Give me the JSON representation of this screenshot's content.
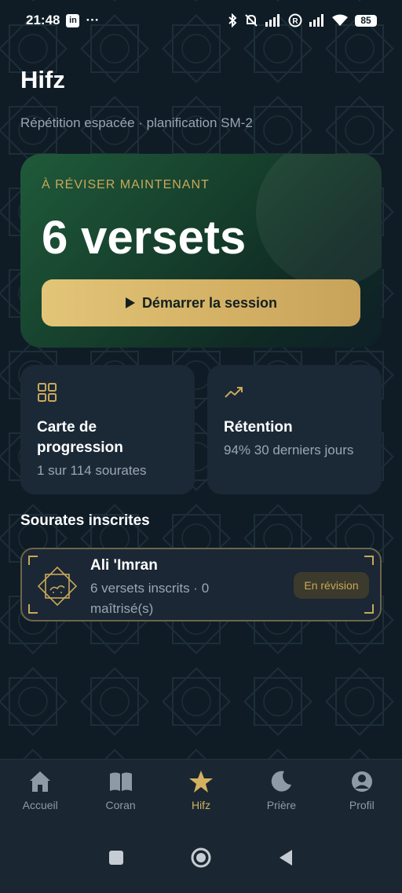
{
  "status_bar": {
    "time": "21:48",
    "left_icons": [
      "linkedin-icon",
      "more-icon"
    ],
    "battery": "85"
  },
  "header": {
    "title": "Hifz",
    "subtitle": "Répétition espacée · planification SM-2"
  },
  "hero": {
    "kicker": "À RÉVISER MAINTENANT",
    "count": "6 versets",
    "button_label": "Démarrer la session",
    "button_icon": "play-icon"
  },
  "stats": {
    "progress": {
      "icon": "grid-icon",
      "title": "Carte de progression",
      "subtitle": "1 sur 114 sourates"
    },
    "retention": {
      "icon": "trending-up-icon",
      "title": "Rétention",
      "subtitle": "94% 30 derniers jours"
    }
  },
  "enrolled": {
    "section_title": "Sourates inscrites",
    "items": [
      {
        "name": "Ali 'Imran",
        "meta": "6 versets inscrits · 0 maîtrisé(s)",
        "badge": "En révision"
      }
    ]
  },
  "bottom_nav": {
    "items": [
      {
        "label": "Accueil",
        "icon": "home-icon",
        "active": false
      },
      {
        "label": "Coran",
        "icon": "book-icon",
        "active": false
      },
      {
        "label": "Hifz",
        "icon": "star-icon",
        "active": true
      },
      {
        "label": "Prière",
        "icon": "moon-icon",
        "active": false
      },
      {
        "label": "Profil",
        "icon": "profile-icon",
        "active": false
      }
    ]
  },
  "colors": {
    "background": "#0f1c26",
    "accent_gold": "#c9a85a",
    "card": "#1b2937",
    "hero_green": "#1f5a3a"
  }
}
